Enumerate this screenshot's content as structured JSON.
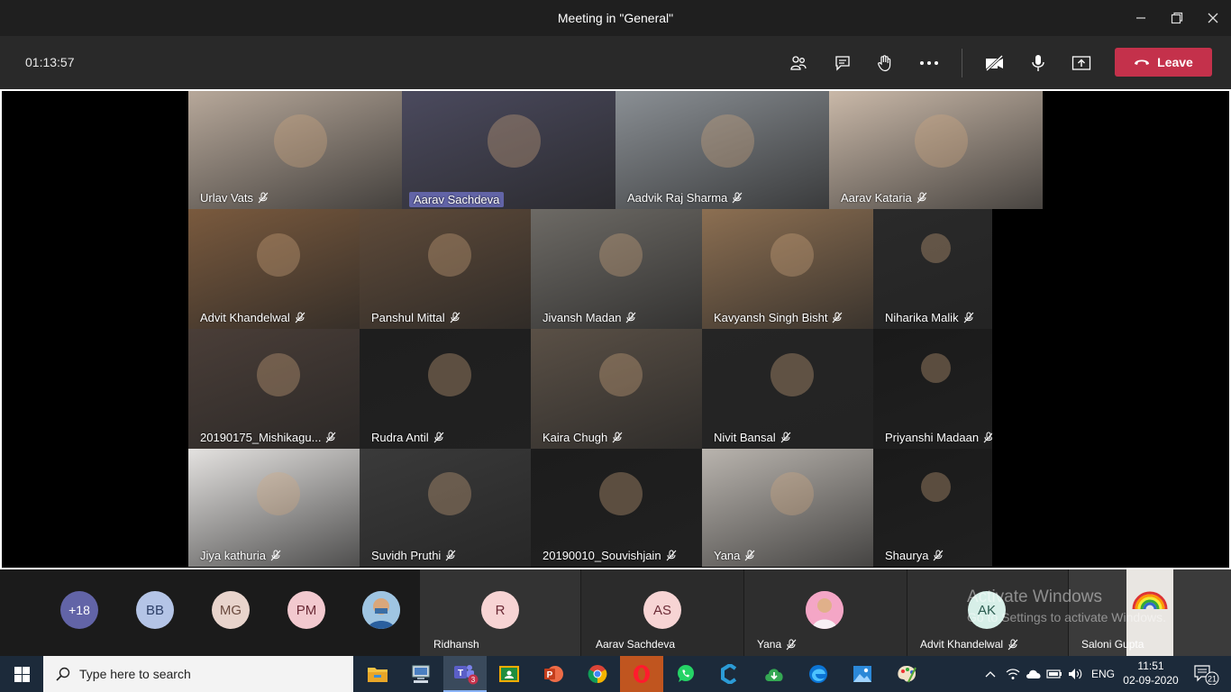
{
  "window": {
    "title": "Meeting in \"General\""
  },
  "toolbar": {
    "timer": "01:13:57",
    "leave_label": "Leave"
  },
  "tiles": [
    {
      "name": "Urlav Vats",
      "highlighted": false
    },
    {
      "name": "Aarav Sachdeva",
      "highlighted": true
    },
    {
      "name": "Aadvik Raj Sharma",
      "highlighted": false
    },
    {
      "name": "Aarav Kataria",
      "highlighted": false
    },
    {
      "name": "Advit Khandelwal",
      "highlighted": false
    },
    {
      "name": "Panshul Mittal",
      "highlighted": false
    },
    {
      "name": "Jivansh Madan",
      "highlighted": false
    },
    {
      "name": "Kavyansh Singh Bisht",
      "highlighted": false
    },
    {
      "name": "Niharika Malik",
      "highlighted": false
    },
    {
      "name": "20190175_Mishikagu...",
      "highlighted": false
    },
    {
      "name": "Rudra Antil",
      "highlighted": false
    },
    {
      "name": "Kaira Chugh",
      "highlighted": false
    },
    {
      "name": "Nivit Bansal",
      "highlighted": false
    },
    {
      "name": "Priyanshi Madaan",
      "highlighted": false
    },
    {
      "name": "Jiya kathuria",
      "highlighted": false
    },
    {
      "name": "Suvidh Pruthi",
      "highlighted": false
    },
    {
      "name": "20190010_Souvishjain",
      "highlighted": false
    },
    {
      "name": "Yana",
      "highlighted": false
    },
    {
      "name": "Shaurya",
      "highlighted": false
    }
  ],
  "strip": {
    "overflow": "+18",
    "avatars": [
      {
        "initials": "BB",
        "bg": "#b4c4e6",
        "fg": "#2c3e66"
      },
      {
        "initials": "MG",
        "bg": "#e8d4cc",
        "fg": "#6a4a3e"
      },
      {
        "initials": "PM",
        "bg": "#f2c9cf",
        "fg": "#6b2a36"
      }
    ],
    "participants": [
      {
        "initials": "R",
        "name": "Ridhansh",
        "muted": false
      },
      {
        "initials": "AS",
        "name": "Aarav Sachdeva",
        "muted": false
      },
      {
        "initials": "",
        "name": "Yana",
        "muted": true
      },
      {
        "initials": "AK",
        "name": "Advit Khandelwal",
        "muted": true
      },
      {
        "initials": "",
        "name": "Saloni Gupta",
        "muted": false
      }
    ]
  },
  "watermark": {
    "line1": "Activate Windows",
    "line2": "Go to Settings to activate Windows."
  },
  "taskbar": {
    "search_placeholder": "Type here to search",
    "teams_badge": "3",
    "language": "ENG",
    "time": "11:51",
    "date": "02-09-2020",
    "notifications": "21"
  },
  "colors": {
    "accent": "#6264a7",
    "leave": "#c4314b",
    "titlebar": "#1f1f1f",
    "toolbar": "#292929"
  }
}
